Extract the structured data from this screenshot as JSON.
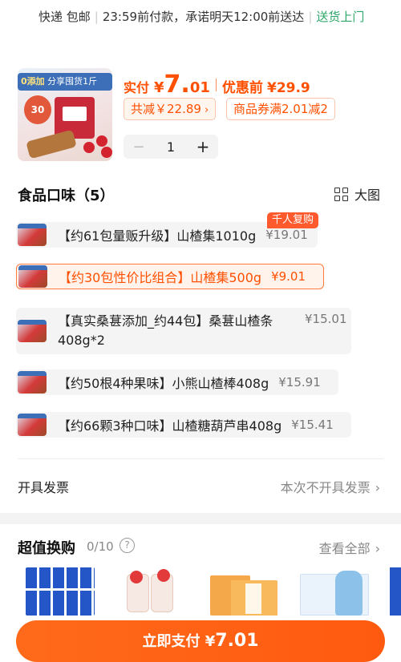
{
  "delivery": {
    "method": "快递 包邮",
    "promise": "23:59前付款，承诺明天12:00前送达",
    "badge": "送货上门"
  },
  "product": {
    "image_banner_left": "0添加",
    "image_banner_right": "分享囤货1斤",
    "image_badge": "30",
    "pay_label": "实付",
    "pay_currency": "¥",
    "pay_integer": "7.",
    "pay_decimal": "01",
    "original_label": "优惠前",
    "original_price": "¥29.9",
    "discount_chip": "共减￥22.89",
    "coupon_chip": "商品券满2.01减2",
    "quantity": "1",
    "minus_symbol": "−",
    "plus_symbol": "+"
  },
  "flavor": {
    "title": "食品口味（5）",
    "big_image_label": "大图",
    "hot_tag": "千人复购",
    "options": [
      {
        "label": "【约61包量贩升级】山楂集1010g",
        "price": "¥19.01"
      },
      {
        "label": "【约30包性价比组合】山楂集500g",
        "price": "¥9.01",
        "selected": true
      },
      {
        "label": "【真实桑葚添加_约44包】桑葚山楂条408g*2",
        "price": "¥15.01"
      },
      {
        "label": "【约50根4种果味】小熊山楂棒408g",
        "price": "¥15.91"
      },
      {
        "label": "【约66颗3种口味】山楂糖葫芦串408g",
        "price": "¥15.41"
      }
    ]
  },
  "invoice": {
    "label": "开具发票",
    "value": "本次不开具发票"
  },
  "trade_in": {
    "title": "超值换购",
    "count": "0/10",
    "help": "?",
    "view_all": "查看全部"
  },
  "pay_button": {
    "label": "立即支付",
    "currency": "¥",
    "amount": "7.01"
  },
  "icons": {
    "chevron": "chevron-right-icon",
    "grid": "grid-icon",
    "help": "question-circle-icon"
  },
  "colors": {
    "accent": "#ff5000",
    "green": "#2ea86a",
    "button": "#ff5a10"
  }
}
